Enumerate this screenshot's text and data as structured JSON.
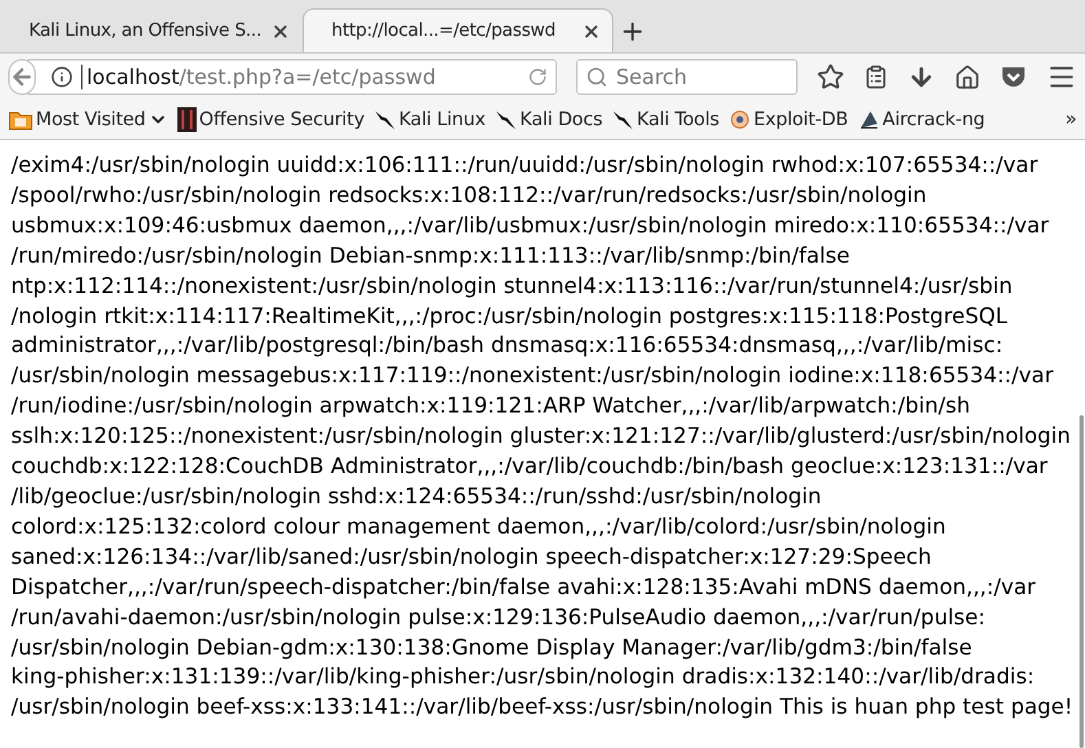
{
  "tabs": [
    {
      "title": "Kali Linux, an Offensive S...",
      "selected": false
    },
    {
      "title": "http://local...=/etc/passwd",
      "selected": true
    }
  ],
  "address_bar": {
    "host": "localhost",
    "path": "/test.php?a=/etc/passwd"
  },
  "search": {
    "placeholder": "Search"
  },
  "bookmarks": [
    {
      "label": "Most Visited",
      "kind": "folder"
    },
    {
      "label": "Offensive Security",
      "kind": "offsec"
    },
    {
      "label": "Kali Linux",
      "kind": "dragon"
    },
    {
      "label": "Kali Docs",
      "kind": "dragon"
    },
    {
      "label": "Kali Tools",
      "kind": "dragon"
    },
    {
      "label": "Exploit-DB",
      "kind": "exploit"
    },
    {
      "label": "Aircrack-ng",
      "kind": "antenna"
    }
  ],
  "bookmarks_overflow": "»",
  "page_lines": [
    "/exim4:/usr/sbin/nologin uuidd:x:106:111::/run/uuidd:/usr/sbin/nologin rwhod:x:107:65534::/var",
    "/spool/rwho:/usr/sbin/nologin redsocks:x:108:112::/var/run/redsocks:/usr/sbin/nologin",
    "usbmux:x:109:46:usbmux daemon,,,:/var/lib/usbmux:/usr/sbin/nologin miredo:x:110:65534::/var",
    "/run/miredo:/usr/sbin/nologin Debian-snmp:x:111:113::/var/lib/snmp:/bin/false",
    "ntp:x:112:114::/nonexistent:/usr/sbin/nologin stunnel4:x:113:116::/var/run/stunnel4:/usr/sbin",
    "/nologin rtkit:x:114:117:RealtimeKit,,,:/proc:/usr/sbin/nologin postgres:x:115:118:PostgreSQL",
    "administrator,,,:/var/lib/postgresql:/bin/bash dnsmasq:x:116:65534:dnsmasq,,,:/var/lib/misc:",
    "/usr/sbin/nologin messagebus:x:117:119::/nonexistent:/usr/sbin/nologin iodine:x:118:65534::/var",
    "/run/iodine:/usr/sbin/nologin arpwatch:x:119:121:ARP Watcher,,,:/var/lib/arpwatch:/bin/sh",
    "sslh:x:120:125::/nonexistent:/usr/sbin/nologin gluster:x:121:127::/var/lib/glusterd:/usr/sbin/nologin",
    "couchdb:x:122:128:CouchDB Administrator,,,:/var/lib/couchdb:/bin/bash geoclue:x:123:131::/var",
    "/lib/geoclue:/usr/sbin/nologin sshd:x:124:65534::/run/sshd:/usr/sbin/nologin",
    "colord:x:125:132:colord colour management daemon,,,:/var/lib/colord:/usr/sbin/nologin",
    "saned:x:126:134::/var/lib/saned:/usr/sbin/nologin speech-dispatcher:x:127:29:Speech",
    "Dispatcher,,,:/var/run/speech-dispatcher:/bin/false avahi:x:128:135:Avahi mDNS daemon,,,:/var",
    "/run/avahi-daemon:/usr/sbin/nologin pulse:x:129:136:PulseAudio daemon,,,:/var/run/pulse:",
    "/usr/sbin/nologin Debian-gdm:x:130:138:Gnome Display Manager:/var/lib/gdm3:/bin/false",
    "king-phisher:x:131:139::/var/lib/king-phisher:/usr/sbin/nologin dradis:x:132:140::/var/lib/dradis:",
    "/usr/sbin/nologin beef-xss:x:133:141::/var/lib/beef-xss:/usr/sbin/nologin This is huan php test page!"
  ]
}
